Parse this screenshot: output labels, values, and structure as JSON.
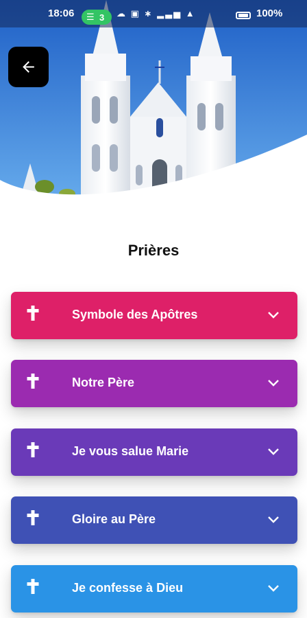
{
  "status_bar": {
    "time": "18:06",
    "notification_count": "3",
    "battery": "100%"
  },
  "header": {
    "back_icon": "arrow-left-icon",
    "image": "church-facade-photo"
  },
  "page": {
    "title": "Prières"
  },
  "prayers": [
    {
      "label": "Symbole des Apôtres",
      "color": "#de2068",
      "icon": "cross-icon"
    },
    {
      "label": "Notre Père",
      "color": "#9b2bb0",
      "icon": "cross-icon"
    },
    {
      "label": "Je vous salue Marie",
      "color": "#6a3ab8",
      "icon": "cross-icon"
    },
    {
      "label": "Gloire au Père",
      "color": "#3f51b5",
      "icon": "cross-icon"
    },
    {
      "label": "Je confesse à Dieu",
      "color": "#2a93e6",
      "icon": "cross-icon"
    }
  ],
  "colors": {
    "sky_top": "#1e63c9",
    "sky_bottom": "#62a8ee",
    "background": "#ffffff"
  }
}
